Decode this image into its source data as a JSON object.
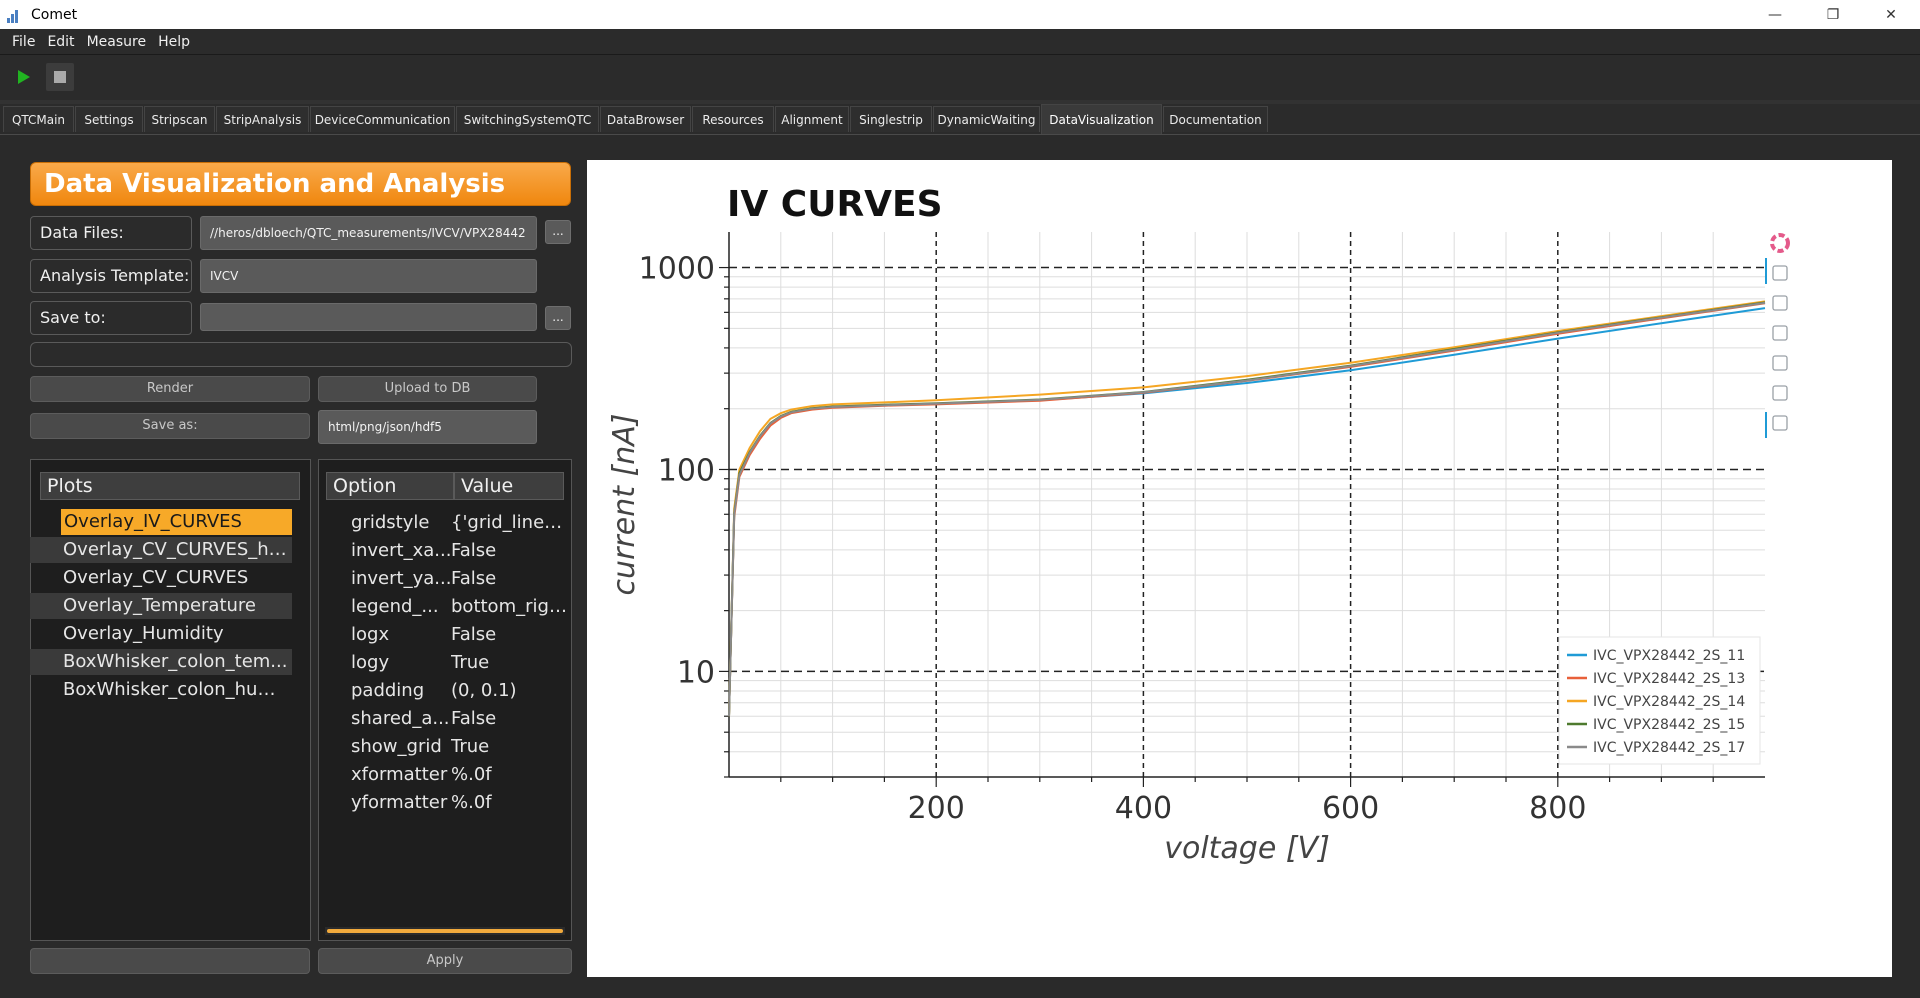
{
  "app": {
    "title": "Comet",
    "window_controls": [
      "—",
      "❐",
      "✕"
    ]
  },
  "menu": [
    "File",
    "Edit",
    "Measure",
    "Help"
  ],
  "toolbar": {
    "run_icon": "play-icon",
    "stop_icon": "stop-icon"
  },
  "tabs": [
    "QTCMain",
    "Settings",
    "Stripscan",
    "StripAnalysis",
    "DeviceCommunication",
    "SwitchingSystemQTC",
    "DataBrowser",
    "Resources",
    "Alignment",
    "Singlestrip",
    "DynamicWaiting",
    "DataVisualization",
    "Documentation"
  ],
  "active_tab": "DataVisualization",
  "panel": {
    "title": "Data Visualization and Analysis",
    "data_files_label": "Data Files:",
    "data_files_value": "//heros/dbloech/QTC_measurements/IVCV/VPX28442",
    "analysis_template_label": "Analysis Template:",
    "analysis_template_value": "IVCV",
    "save_to_label": "Save to:",
    "save_to_value": "",
    "browse": "...",
    "render_button": "Render",
    "upload_button": "Upload to DB",
    "save_as_button": "Save as:",
    "save_as_formats": "html/png/json/hdf5",
    "apply_button": "Apply"
  },
  "plots": {
    "header": "Plots",
    "items": [
      "Overlay_IV_CURVES",
      "Overlay_CV_CURVES_hy...",
      "Overlay_CV_CURVES",
      "Overlay_Temperature",
      "Overlay_Humidity",
      "BoxWhisker_colon_tem...",
      "BoxWhisker_colon_hum..."
    ],
    "selected": "Overlay_IV_CURVES"
  },
  "options": {
    "header_option": "Option",
    "header_value": "Value",
    "rows": [
      {
        "k": "gridstyle",
        "v": "{'grid_line_c..."
      },
      {
        "k": "invert_xa...",
        "v": "False"
      },
      {
        "k": "invert_ya...",
        "v": "False"
      },
      {
        "k": "legend_...",
        "v": "bottom_right"
      },
      {
        "k": "logx",
        "v": "False"
      },
      {
        "k": "logy",
        "v": "True"
      },
      {
        "k": "padding",
        "v": "(0, 0.1)"
      },
      {
        "k": "shared_a...",
        "v": "False"
      },
      {
        "k": "show_grid",
        "v": "True"
      },
      {
        "k": "xformatter",
        "v": "%.0f"
      },
      {
        "k": "yformatter",
        "v": "%.0f"
      }
    ]
  },
  "chart_data": {
    "type": "line",
    "title": "IV CURVES",
    "xlabel": "voltage [V]",
    "ylabel": "current [nA]",
    "xlim": [
      0,
      1000
    ],
    "ylim": [
      3,
      1500
    ],
    "log_y": true,
    "x_ticks": [
      200,
      400,
      600,
      800
    ],
    "y_ticks": [
      10,
      100,
      1000
    ],
    "grid": true,
    "legend_position": "bottom_right",
    "x": [
      0,
      5,
      10,
      20,
      30,
      40,
      50,
      60,
      80,
      100,
      150,
      200,
      300,
      400,
      500,
      600,
      700,
      800,
      900,
      1000
    ],
    "series": [
      {
        "name": "IVC_VPX28442_2S_11",
        "color": "#1f9bd6",
        "values": [
          6,
          60,
          95,
          120,
          145,
          168,
          182,
          192,
          200,
          204,
          208,
          212,
          220,
          238,
          268,
          310,
          370,
          445,
          530,
          630
        ]
      },
      {
        "name": "IVC_VPX28442_2S_13",
        "color": "#e8603a",
        "values": [
          6,
          58,
          92,
          118,
          142,
          165,
          180,
          190,
          198,
          202,
          207,
          210,
          219,
          240,
          275,
          322,
          388,
          470,
          560,
          665
        ]
      },
      {
        "name": "IVC_VPX28442_2S_14",
        "color": "#f5a623",
        "values": [
          6,
          64,
          100,
          128,
          155,
          178,
          190,
          198,
          206,
          210,
          215,
          220,
          235,
          255,
          290,
          338,
          403,
          485,
          575,
          680
        ]
      },
      {
        "name": "IVC_VPX28442_2S_15",
        "color": "#4e7a2e",
        "values": [
          6,
          61,
          96,
          122,
          147,
          170,
          184,
          193,
          201,
          205,
          209,
          213,
          222,
          242,
          278,
          327,
          395,
          478,
          568,
          672
        ]
      },
      {
        "name": "IVC_VPX28442_2S_17",
        "color": "#8a8a8a",
        "values": [
          6,
          60,
          94,
          121,
          146,
          169,
          183,
          192,
          200,
          204,
          208,
          212,
          221,
          241,
          276,
          325,
          392,
          475,
          565,
          668
        ]
      }
    ]
  }
}
